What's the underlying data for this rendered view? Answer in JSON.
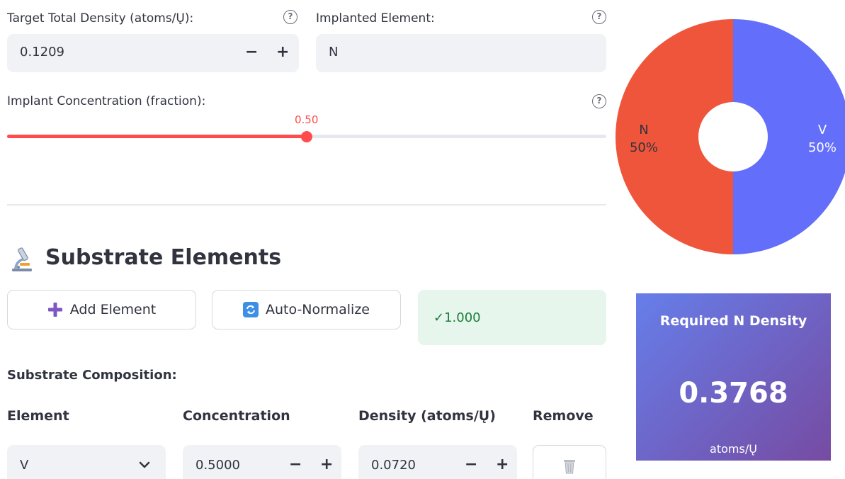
{
  "density": {
    "label": "Target Total Density (atoms/Ų):",
    "value": "0.1209",
    "minus": "−",
    "plus": "+"
  },
  "implanted": {
    "label": "Implanted Element:",
    "value": "N"
  },
  "concentration": {
    "label": "Implant Concentration (fraction):",
    "value_label": "0.50",
    "value": 0.5
  },
  "help_glyph": "?",
  "substrate": {
    "title": "Substrate Elements",
    "add_label": "Add Element",
    "normalize_label": "Auto-Normalize",
    "status": "✓1.000",
    "composition_label": "Substrate Composition:",
    "headers": [
      "Element",
      "Concentration",
      "Density (atoms/Ų)",
      "Remove"
    ],
    "rows": [
      {
        "element": "V",
        "concentration": "0.5000",
        "density": "0.0720"
      }
    ]
  },
  "chart_data": {
    "type": "pie",
    "donut": true,
    "categories": [
      "N",
      "V"
    ],
    "values": [
      50,
      50
    ],
    "labels": [
      "50%",
      "50%"
    ],
    "colors": [
      "#ef553b",
      "#636efa"
    ]
  },
  "metric": {
    "title": "Required N Density",
    "value": "0.3768",
    "unit": "atoms/Ų"
  },
  "colors": {
    "accent": "#ff4b4b",
    "field_bg": "#f0f2f6",
    "success_bg": "#e6f6ec",
    "success_text": "#1e7d3a",
    "metric_gradient_start": "#667eea",
    "metric_gradient_end": "#764ba2"
  }
}
